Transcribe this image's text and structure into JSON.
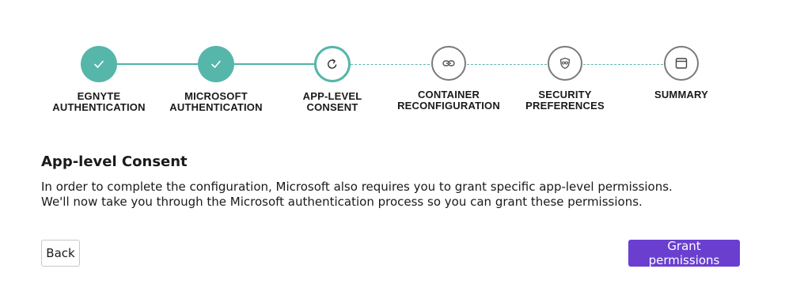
{
  "colors": {
    "accent_teal": "#55b6a9",
    "primary_button": "#6a3fd0",
    "inactive_border": "#7a7a7a"
  },
  "stepper": {
    "steps": [
      {
        "line1": "EGNYTE",
        "line2": "AUTHENTICATION",
        "status": "completed",
        "icon": "checkmark-icon"
      },
      {
        "line1": "MICROSOFT",
        "line2": "AUTHENTICATION",
        "status": "completed",
        "icon": "checkmark-icon"
      },
      {
        "line1": "APP-LEVEL",
        "line2": "CONSENT",
        "status": "current",
        "icon": "refresh-icon"
      },
      {
        "line1": "CONTAINER",
        "line2": "RECONFIGURATION",
        "status": "pending",
        "icon": "link-icon"
      },
      {
        "line1": "SECURITY",
        "line2": "PREFERENCES",
        "status": "pending",
        "icon": "shield-icon"
      },
      {
        "line1": "SUMMARY",
        "line2": "",
        "status": "pending",
        "icon": "window-icon"
      }
    ]
  },
  "content": {
    "title": "App-level Consent",
    "description_line1": "In order to complete the configuration, Microsoft also requires you to grant specific app-level permissions.",
    "description_line2": "We'll now take you through the Microsoft authentication process so you can grant these permissions."
  },
  "actions": {
    "back_label": "Back",
    "grant_label": "Grant permissions"
  }
}
